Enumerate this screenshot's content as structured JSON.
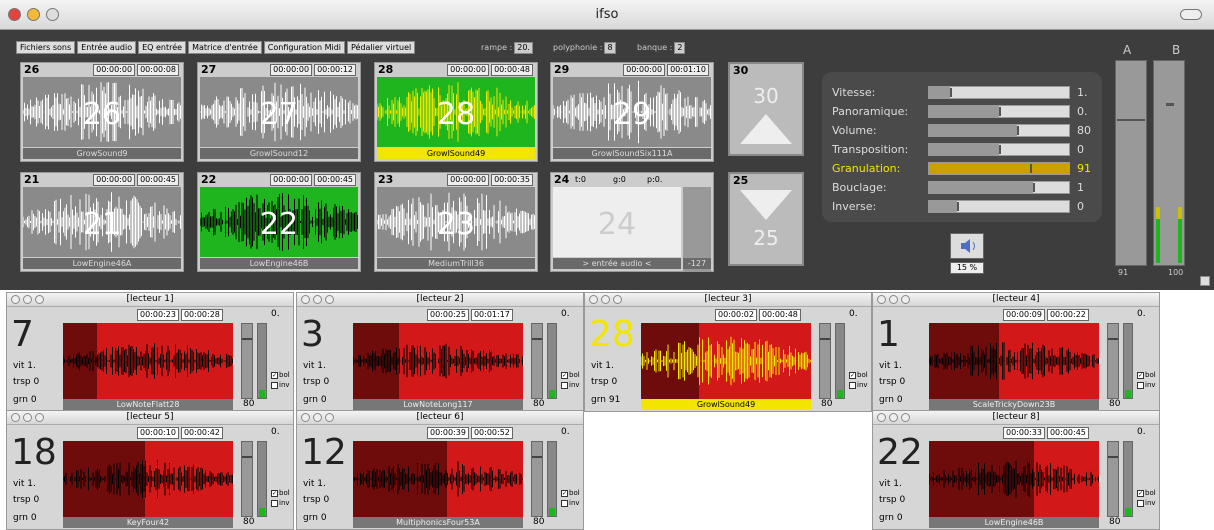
{
  "window": {
    "title": "ifso"
  },
  "tabs": [
    "Fichiers sons",
    "Entrée audio",
    "EQ entrée",
    "Matrice d'entrée",
    "Configuration Midi",
    "Pédalier virtuel"
  ],
  "params_top": {
    "rampe_label": "rampe :",
    "rampe_value": "20.",
    "poly_label": "polyphonie :",
    "poly_value": "8",
    "banque_label": "banque :",
    "banque_value": "2"
  },
  "cells": [
    {
      "num": "26",
      "t1": "00:00:00",
      "t2": "00:00:08",
      "big": "26",
      "name": "GrowSound9",
      "highlight": false
    },
    {
      "num": "27",
      "t1": "00:00:00",
      "t2": "00:00:12",
      "big": "27",
      "name": "GrowlSound12",
      "highlight": false
    },
    {
      "num": "28",
      "t1": "00:00:00",
      "t2": "00:00:48",
      "big": "28",
      "name": "GrowlSound49",
      "highlight": true
    },
    {
      "num": "29",
      "t1": "00:00:00",
      "t2": "00:01:10",
      "big": "29",
      "name": "GrowlSoundSix111A",
      "highlight": false
    },
    {
      "num": "21",
      "t1": "00:00:00",
      "t2": "00:00:45",
      "big": "21",
      "name": "LowEngine46A",
      "highlight": false
    },
    {
      "num": "22",
      "t1": "00:00:00",
      "t2": "00:00:45",
      "big": "22",
      "name": "LowEngine46B",
      "highlight": false
    },
    {
      "num": "23",
      "t1": "00:00:00",
      "t2": "00:00:35",
      "big": "23",
      "name": "MediumTrill36",
      "highlight": false
    }
  ],
  "audio_cell": {
    "num": "24",
    "t": "t:0",
    "g": "g:0",
    "p": "p:0.",
    "big": "24",
    "name": "> entrée audio <",
    "level": "-127"
  },
  "nav": {
    "up_num": "30",
    "up_big": "30",
    "down_num": "25",
    "down_big": "25"
  },
  "param_panel": [
    {
      "label": "Vitesse:",
      "value": "1.",
      "fill": 0.15,
      "highlight": false
    },
    {
      "label": "Panoramique:",
      "value": "0.",
      "fill": 0.5,
      "highlight": false
    },
    {
      "label": "Volume:",
      "value": "80",
      "fill": 0.63,
      "highlight": false
    },
    {
      "label": "Transposition:",
      "value": "0",
      "fill": 0.5,
      "highlight": false
    },
    {
      "label": "Granulation:",
      "value": "91",
      "fill": 0.72,
      "highlight": true
    },
    {
      "label": "Bouclage:",
      "value": "1",
      "fill": 0.74,
      "highlight": false
    },
    {
      "label": "Inverse:",
      "value": "0",
      "fill": 0.2,
      "highlight": false
    }
  ],
  "speaker": {
    "percent": "15 %"
  },
  "vu": {
    "a_label": "A",
    "b_label": "B",
    "a_value": "91",
    "b_value": "100"
  },
  "players": [
    {
      "title": "[lecteur 1]",
      "num": "7",
      "t1": "00:00:23",
      "t2": "00:00:28",
      "vit": "1.",
      "trsp": "0",
      "grn": "0",
      "name": "LowNoteFlatt28",
      "vol": "80",
      "zero": "0.",
      "bol": "bol",
      "inv": "inv",
      "bolchk": true,
      "active": false
    },
    {
      "title": "[lecteur 2]",
      "num": "3",
      "t1": "00:00:25",
      "t2": "00:01:17",
      "vit": "1.",
      "trsp": "0",
      "grn": "0",
      "name": "LowNoteLong117",
      "vol": "80",
      "zero": "0.",
      "bol": "bol",
      "inv": "inv",
      "bolchk": true,
      "active": false
    },
    {
      "title": "[lecteur 3]",
      "num": "28",
      "t1": "00:00:02",
      "t2": "00:00:48",
      "vit": "1.",
      "trsp": "0",
      "grn": "91",
      "name": "GrowlSound49",
      "vol": "80",
      "zero": "0.",
      "bol": "bol",
      "inv": "inv",
      "bolchk": true,
      "active": true
    },
    {
      "title": "[lecteur 4]",
      "num": "1",
      "t1": "00:00:09",
      "t2": "00:00:22",
      "vit": "1.",
      "trsp": "0",
      "grn": "0",
      "name": "ScaleTrickyDown23B",
      "vol": "80",
      "zero": "0.",
      "bol": "bol",
      "inv": "inv",
      "bolchk": true,
      "active": false
    },
    {
      "title": "[lecteur 5]",
      "num": "18",
      "t1": "00:00:10",
      "t2": "00:00:42",
      "vit": "1.",
      "trsp": "0",
      "grn": "0",
      "name": "KeyFour42",
      "vol": "80",
      "zero": "0.",
      "bol": "bol",
      "inv": "inv",
      "bolchk": true,
      "active": false
    },
    {
      "title": "[lecteur 6]",
      "num": "12",
      "t1": "00:00:39",
      "t2": "00:00:52",
      "vit": "1.",
      "trsp": "0",
      "grn": "0",
      "name": "MultiphonicsFour53A",
      "vol": "80",
      "zero": "0.",
      "bol": "bol",
      "inv": "inv",
      "bolchk": true,
      "active": false
    },
    {
      "title": "[lecteur 8]",
      "num": "22",
      "t1": "00:00:33",
      "t2": "00:00:45",
      "vit": "1.",
      "trsp": "0",
      "grn": "0",
      "name": "LowEngine46B",
      "vol": "80",
      "zero": "0.",
      "bol": "bol",
      "inv": "inv",
      "bolchk": true,
      "active": false
    }
  ],
  "labels": {
    "vit": "vit",
    "trsp": "trsp",
    "grn": "grn"
  },
  "colors": {
    "green": "#1fb51f",
    "yellow": "#f2e600",
    "red": "#d21818",
    "darkred": "#6e0c0c"
  }
}
